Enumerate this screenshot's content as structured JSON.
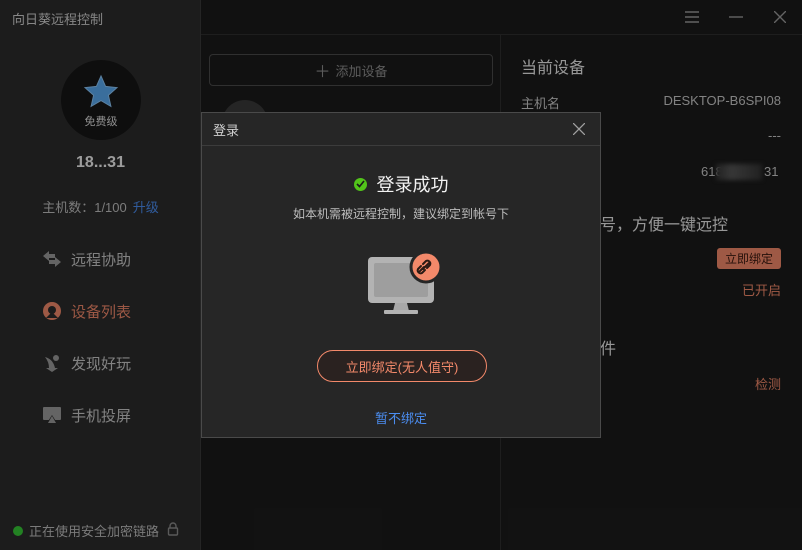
{
  "app": {
    "title": "向日葵远程控制"
  },
  "sidebar": {
    "level_label": "免费级",
    "username": "18...31",
    "host_count_label": "主机数：1/100",
    "upgrade_label": "升级",
    "nav": [
      {
        "label": "远程协助",
        "icon": "remote-assist-icon"
      },
      {
        "label": "设备列表",
        "icon": "device-list-icon",
        "active": true
      },
      {
        "label": "发现好玩",
        "icon": "discover-icon"
      },
      {
        "label": "手机投屏",
        "icon": "screen-cast-icon"
      }
    ],
    "secure_status": "正在使用安全加密链路"
  },
  "middle": {
    "add_device_label": "添加设备"
  },
  "right": {
    "title": "当前设备",
    "hostname_label": "主机名",
    "hostname_value": "DESKTOP-B6SPI08",
    "dash_value": "---",
    "ip_head": "618",
    "ip_tail": "31",
    "bind_hint": "号，方便一键远控",
    "bind_pill": "立即绑定",
    "enabled_status": "已开启",
    "plugin_label": "件",
    "detect_label": "检测"
  },
  "modal": {
    "title": "登录",
    "success_text": "登录成功",
    "subtitle": "如本机需被远程控制，建议绑定到帐号下",
    "bind_button": "立即绑定(无人值守)",
    "skip_link": "暂不绑定"
  },
  "colors": {
    "accent": "#f3896a",
    "link": "#4b8df0",
    "success": "#52c41a",
    "star": "#5aa9f0"
  }
}
